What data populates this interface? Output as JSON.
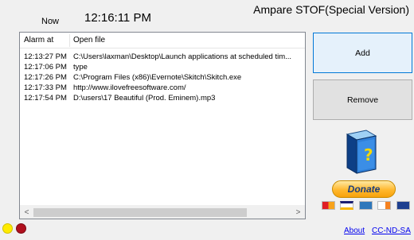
{
  "header": {
    "now_label": "Now",
    "clock": "12:16:11 PM",
    "app_title": "Ampare  STOF(Special Version)"
  },
  "list": {
    "columns": [
      "Alarm at",
      "Open file"
    ],
    "rows": [
      {
        "time": "12:13:27 PM",
        "file": "C:\\Users\\laxman\\Desktop\\Launch applications at scheduled tim..."
      },
      {
        "time": "12:17:06 PM",
        "file": "type"
      },
      {
        "time": "12:17:26 PM",
        "file": "C:\\Program Files (x86)\\Evernote\\Skitch\\Skitch.exe"
      },
      {
        "time": "12:17:33 PM",
        "file": "http://www.ilovefreesoftware.com/"
      },
      {
        "time": "12:17:54 PM",
        "file": "D:\\users\\17 Beautiful (Prod. Eminem).mp3"
      }
    ],
    "scroll_left_glyph": "<",
    "scroll_right_glyph": ">"
  },
  "buttons": {
    "add": "Add",
    "remove": "Remove",
    "donate": "Donate"
  },
  "icons": {
    "book": "help-book-icon",
    "cards": [
      "mastercard-icon",
      "visa-icon",
      "amex-icon",
      "discover-icon",
      "bank-icon"
    ]
  },
  "status_dots": {
    "yellow": "#ffeb00",
    "red": "#b0101e"
  },
  "links": {
    "about": "About",
    "license": "CC-ND-SA"
  }
}
